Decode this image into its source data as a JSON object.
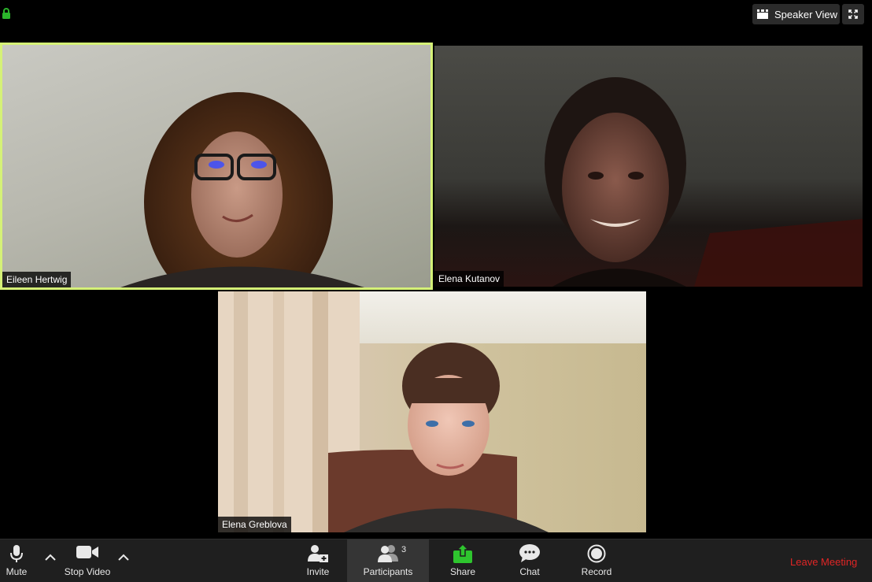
{
  "top_bar": {
    "speaker_view_label": "Speaker View"
  },
  "tiles": [
    {
      "name": "Eileen Hertwig",
      "active_speaker": true
    },
    {
      "name": "Elena Kutanov",
      "active_speaker": false
    },
    {
      "name": "Elena Greblova",
      "active_speaker": false
    }
  ],
  "toolbar": {
    "mute_label": "Mute",
    "stop_video_label": "Stop Video",
    "invite_label": "Invite",
    "participants_label": "Participants",
    "participants_count": "3",
    "share_label": "Share",
    "chat_label": "Chat",
    "record_label": "Record",
    "leave_label": "Leave Meeting"
  },
  "colors": {
    "active_border": "#d5f177",
    "share_green": "#2ec52e",
    "leave_red": "#e02525",
    "lock_green": "#2bb52b"
  },
  "icons": [
    "lock-icon",
    "speaker-view-icon",
    "fullscreen-icon",
    "microphone-icon",
    "camera-icon",
    "chevron-up-icon",
    "add-person-icon",
    "participants-icon",
    "share-screen-icon",
    "chat-bubble-icon",
    "record-icon"
  ]
}
